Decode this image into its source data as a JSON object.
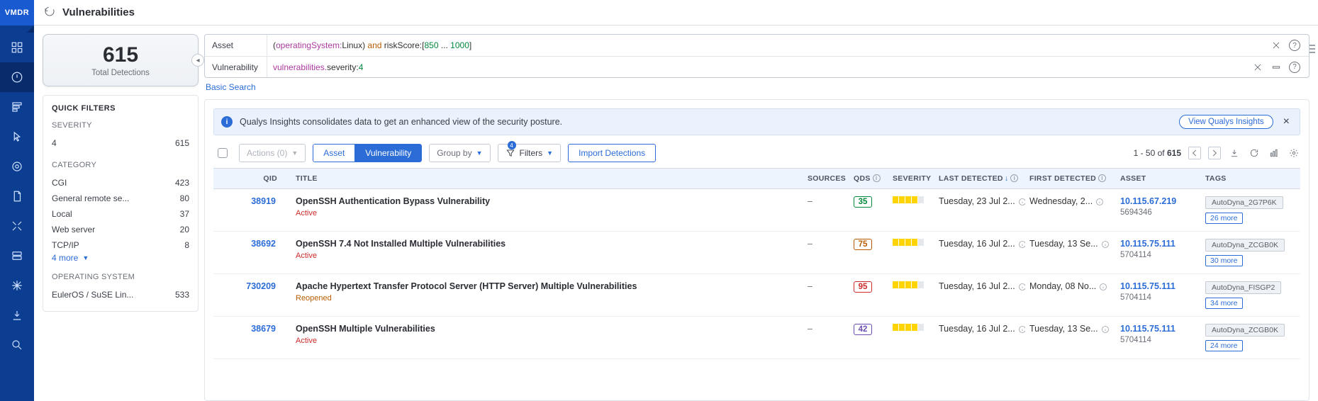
{
  "brand": "VMDR",
  "page_title": "Vulnerabilities",
  "metric": {
    "value": "615",
    "label": "Total Detections"
  },
  "search": {
    "asset_label": "Asset",
    "vuln_label": "Vulnerability",
    "asset_query": {
      "p1": "(",
      "fn1": "operatingSystem:",
      "v1": "Linux",
      "p2": ") ",
      "kw": "and ",
      "fn2": "riskScore:",
      "br1": "[",
      "n1": "850",
      "el": " ... ",
      "n2": "1000",
      "br2": "]"
    },
    "vuln_query": {
      "fn": "vulnerabilities.",
      "k": "severity:",
      "v": "4"
    },
    "basic": "Basic Search"
  },
  "banner": {
    "text": "Qualys Insights consolidates data to get an enhanced view of the security posture.",
    "cta": "View Qualys Insights"
  },
  "toolbar": {
    "actions": "Actions (0)",
    "seg_asset": "Asset",
    "seg_vuln": "Vulnerability",
    "groupby": "Group by",
    "filters": "Filters",
    "filters_badge": "4",
    "import": "Import Detections",
    "range_prefix": "1 - 50 of ",
    "range_total": "615"
  },
  "quickfilters": {
    "title": "QUICK FILTERS",
    "sections": [
      {
        "head": "SEVERITY",
        "rows": [
          {
            "label": "4",
            "count": "615"
          }
        ]
      },
      {
        "head": "CATEGORY",
        "rows": [
          {
            "label": "CGI",
            "count": "423"
          },
          {
            "label": "General remote se...",
            "count": "80"
          },
          {
            "label": "Local",
            "count": "37"
          },
          {
            "label": "Web server",
            "count": "20"
          },
          {
            "label": "TCP/IP",
            "count": "8"
          }
        ],
        "more": "4 more"
      },
      {
        "head": "OPERATING SYSTEM",
        "rows": [
          {
            "label": "EulerOS / SuSE Lin...",
            "count": "533"
          }
        ]
      }
    ]
  },
  "columns": {
    "qid": "QID",
    "title": "TITLE",
    "sources": "SOURCES",
    "qds": "QDS",
    "severity": "SEVERITY",
    "last": "LAST DETECTED",
    "first": "FIRST DETECTED",
    "asset": "ASSET",
    "tags": "TAGS"
  },
  "rows": [
    {
      "qid": "38919",
      "title": "OpenSSH Authentication Bypass Vulnerability",
      "status": "Active",
      "status_cls": "active",
      "sources": "–",
      "qds": "35",
      "qds_cls": "green",
      "sev": 4,
      "last": "Tuesday, 23 Jul 2...",
      "first": "Wednesday, 2...",
      "asset_ip": "10.115.67.219",
      "asset_id": "5694346",
      "tag": "AutoDyna_2G7P6K",
      "more": "26 more"
    },
    {
      "qid": "38692",
      "title": "OpenSSH 7.4 Not Installed Multiple Vulnerabilities",
      "status": "Active",
      "status_cls": "active",
      "sources": "–",
      "qds": "75",
      "qds_cls": "orange",
      "sev": 4,
      "last": "Tuesday, 16 Jul 2...",
      "first": "Tuesday, 13 Se...",
      "asset_ip": "10.115.75.111",
      "asset_id": "5704114",
      "tag": "AutoDyna_ZCGB0K",
      "more": "30 more"
    },
    {
      "qid": "730209",
      "title": "Apache Hypertext Transfer Protocol Server (HTTP Server) Multiple Vulnerabilities",
      "status": "Reopened",
      "status_cls": "reopen",
      "sources": "–",
      "qds": "95",
      "qds_cls": "red",
      "sev": 4,
      "last": "Tuesday, 16 Jul 2...",
      "first": "Monday, 08 No...",
      "asset_ip": "10.115.75.111",
      "asset_id": "5704114",
      "tag": "AutoDyna_FISGP2",
      "more": "34 more"
    },
    {
      "qid": "38679",
      "title": "OpenSSH Multiple Vulnerabilities",
      "status": "Active",
      "status_cls": "active",
      "sources": "–",
      "qds": "42",
      "qds_cls": "violet",
      "sev": 4,
      "last": "Tuesday, 16 Jul 2...",
      "first": "Tuesday, 13 Se...",
      "asset_ip": "10.115.75.111",
      "asset_id": "5704114",
      "tag": "AutoDyna_ZCGB0K",
      "more": "24 more"
    }
  ]
}
